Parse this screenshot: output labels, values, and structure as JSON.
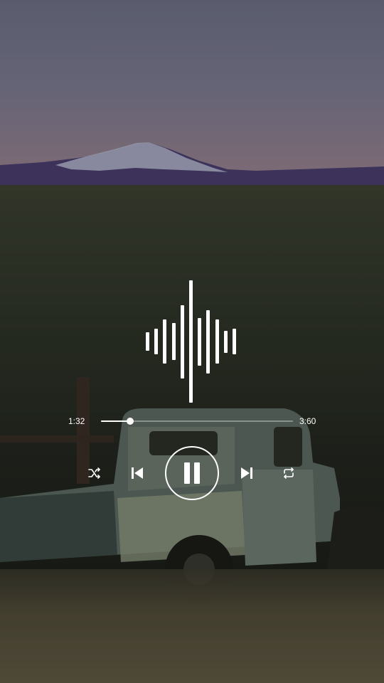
{
  "player": {
    "time_elapsed": "1:32",
    "time_total": "3:60",
    "progress_fraction": 0.15
  },
  "waveform": {
    "levels": [
      0.15,
      0.21,
      0.36,
      0.3,
      0.6,
      1.0,
      0.39,
      0.52,
      0.36,
      0.18,
      0.21
    ]
  },
  "controls": {
    "icons": [
      "shuffle-icon",
      "previous-icon",
      "pause-icon",
      "next-icon",
      "repeat-icon"
    ]
  },
  "colors": {
    "accent": "#ffffff"
  }
}
